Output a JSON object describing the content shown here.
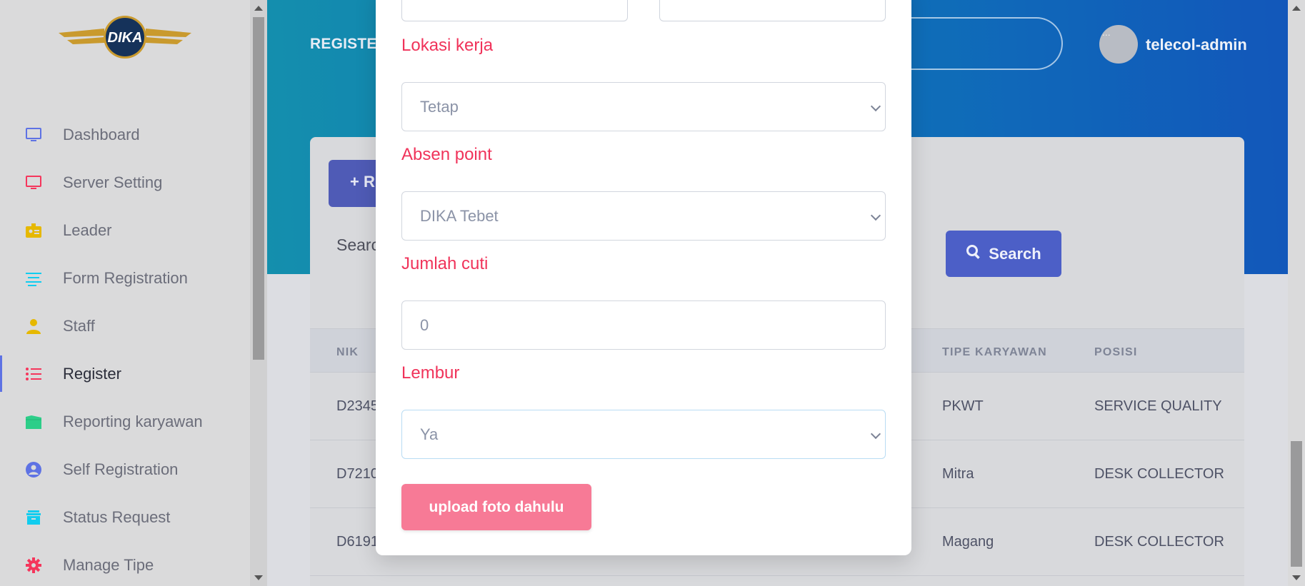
{
  "sidebar": {
    "logo_text": "DIKA",
    "items": [
      {
        "label": "Dashboard",
        "icon": "monitor-icon",
        "color": "#5e72e4"
      },
      {
        "label": "Server Setting",
        "icon": "monitor-icon",
        "color": "#f5365c"
      },
      {
        "label": "Leader",
        "icon": "badge-icon",
        "color": "#e6b800"
      },
      {
        "label": "Form Registration",
        "icon": "align-left-icon",
        "color": "#11cdef"
      },
      {
        "label": "Staff",
        "icon": "user-icon",
        "color": "#e6b800"
      },
      {
        "label": "Register",
        "icon": "list-icon",
        "color": "#f5365c"
      },
      {
        "label": "Reporting karyawan",
        "icon": "folder-icon",
        "color": "#2dce89"
      },
      {
        "label": "Self Registration",
        "icon": "user-circle-icon",
        "color": "#5e72e4"
      },
      {
        "label": "Status Request",
        "icon": "archive-icon",
        "color": "#11cdef"
      },
      {
        "label": "Manage Tipe",
        "icon": "gear-icon",
        "color": "#f5365c"
      }
    ]
  },
  "header": {
    "brand": "REGISTER",
    "username": "telecol-admin",
    "avatar_alt": "..."
  },
  "card": {
    "add_button_label": "+ R",
    "search_label": "Searc",
    "search_button": "Search",
    "table": {
      "columns": [
        "NIK",
        "TIPE KARYAWAN",
        "POSISI"
      ],
      "rows": [
        {
          "nik": "D2345",
          "tipe": "PKWT",
          "posisi": "SERVICE QUALITY"
        },
        {
          "nik": "D7210",
          "tipe": "Mitra",
          "posisi": "DESK COLLECTOR"
        },
        {
          "nik": "D6191",
          "tipe": "Magang",
          "posisi": "DESK COLLECTOR"
        }
      ]
    }
  },
  "modal": {
    "lokasi_label": "Lokasi kerja",
    "lokasi_value": "Tetap",
    "absen_label": "Absen point",
    "absen_value": "DIKA Tebet",
    "cuti_label": "Jumlah cuti",
    "cuti_value": "0",
    "lembur_label": "Lembur",
    "lembur_value": "Ya",
    "upload_button": "upload foto dahulu"
  },
  "colors": {
    "accent": "#5e72e4",
    "label_red": "#f0335a",
    "upload_pink": "#f77a96"
  }
}
